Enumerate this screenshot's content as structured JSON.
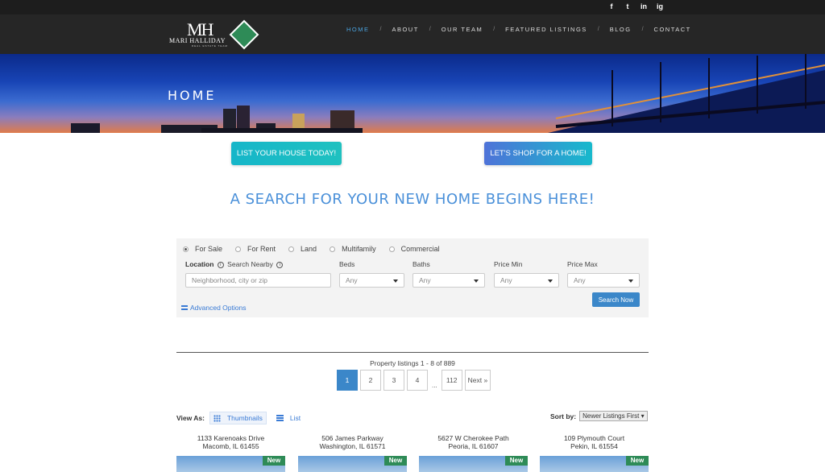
{
  "social": [
    "f",
    "t",
    "in",
    "ig"
  ],
  "social_icons": [
    "facebook-icon",
    "twitter-icon",
    "linkedin-icon",
    "instagram-icon"
  ],
  "logo": {
    "mark": "MH",
    "name": "MARI HALLIDAY",
    "sub": "REAL ESTATE TEAM"
  },
  "nav": [
    "HOME",
    "ABOUT",
    "OUR TEAM",
    "FEATURED LISTINGS",
    "BLOG",
    "CONTACT"
  ],
  "nav_separator": "/",
  "hero": {
    "title": "HOME"
  },
  "cta": {
    "list_house": "LIST YOUR HOUSE TODAY!",
    "shop_home": "LET'S SHOP FOR A HOME!"
  },
  "headline": "A SEARCH FOR YOUR NEW HOME BEGINS HERE!",
  "search": {
    "types": [
      "For Sale",
      "For Rent",
      "Land",
      "Multifamily",
      "Commercial"
    ],
    "selected_type": "For Sale",
    "location_label": "Location",
    "nearby_label": "Search Nearby",
    "location_placeholder": "Neighborhood, city or zip",
    "beds_label": "Beds",
    "baths_label": "Baths",
    "price_min_label": "Price Min",
    "price_max_label": "Price Max",
    "any": "Any",
    "advanced": "Advanced Options",
    "search_button": "Search Now"
  },
  "results": {
    "count_text": "Property listings 1 - 8 of 889",
    "pages": [
      "1",
      "2",
      "3",
      "4",
      "112"
    ],
    "ellipsis": "...",
    "next": "Next »"
  },
  "view": {
    "label": "View As:",
    "thumbnails": "Thumbnails",
    "list": "List"
  },
  "sort": {
    "label": "Sort by:",
    "value": "Newer Listings First"
  },
  "listings": [
    {
      "street": "1133 Karenoaks Drive",
      "city": "Macomb, IL 61455",
      "badge": "New"
    },
    {
      "street": "506 James Parkway",
      "city": "Washington, IL 61571",
      "badge": "New"
    },
    {
      "street": "5627 W Cherokee Path",
      "city": "Peoria, IL 61607",
      "badge": "New"
    },
    {
      "street": "109 Plymouth Court",
      "city": "Pekin, IL 61554",
      "badge": "New"
    }
  ],
  "colors": {
    "accent": "#4a90d9",
    "header_bg": "#262626",
    "cta_teal": "#16b6c9",
    "new_badge": "#2e8b57"
  }
}
